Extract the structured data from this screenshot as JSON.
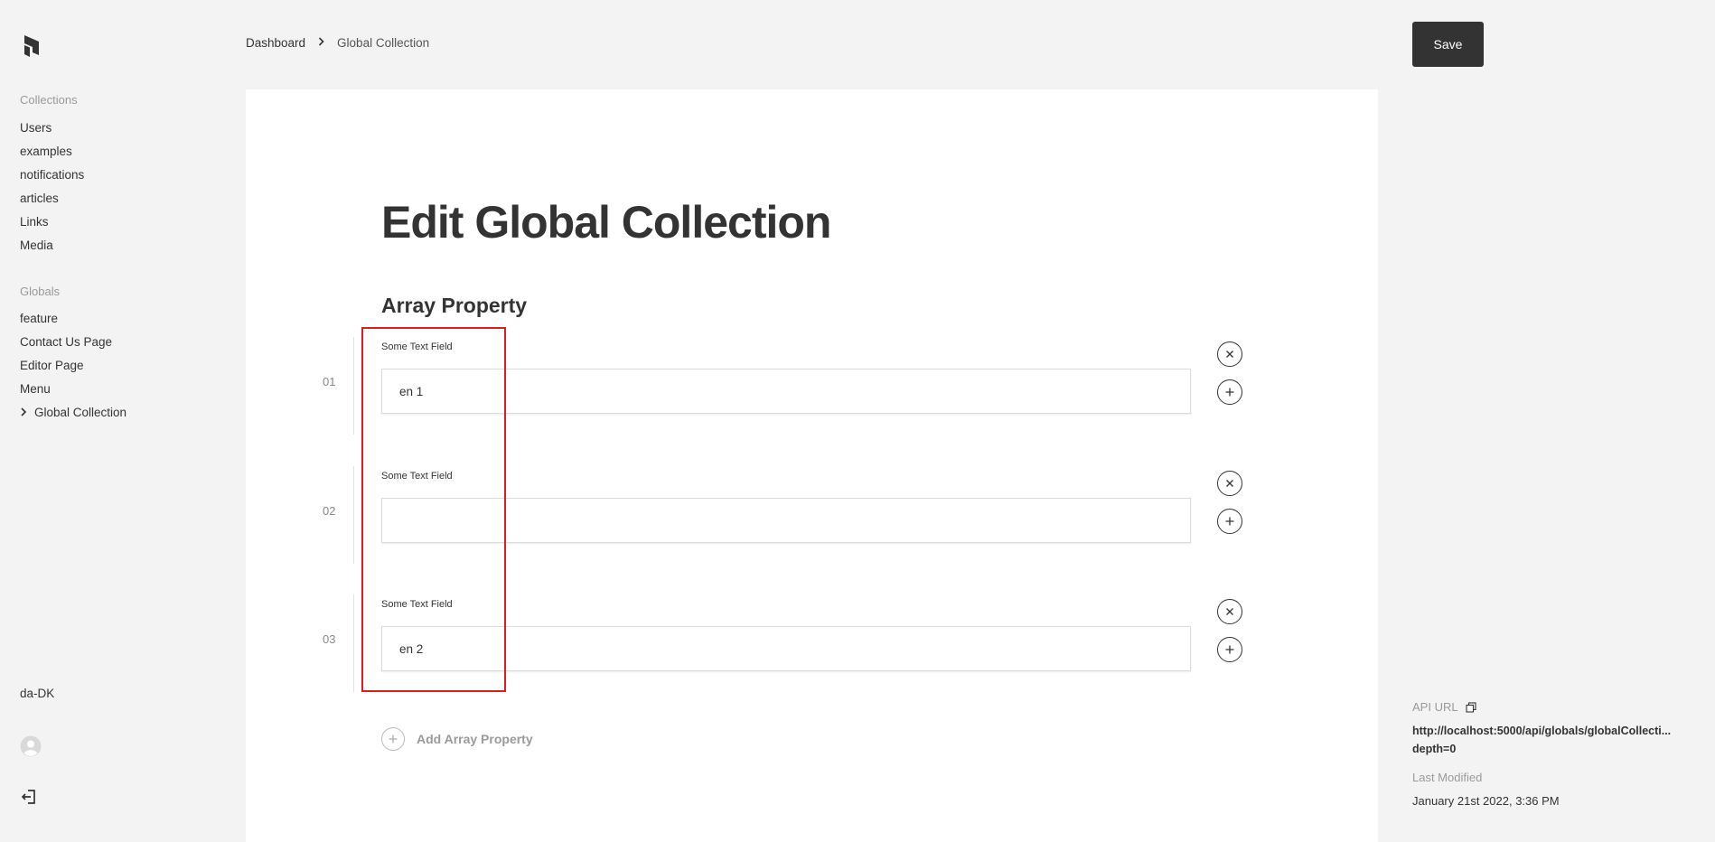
{
  "sidebar": {
    "collections_label": "Collections",
    "collections": [
      {
        "label": "Users"
      },
      {
        "label": "examples"
      },
      {
        "label": "notifications"
      },
      {
        "label": "articles"
      },
      {
        "label": "Links"
      },
      {
        "label": "Media"
      }
    ],
    "globals_label": "Globals",
    "globals": [
      {
        "label": "feature"
      },
      {
        "label": "Contact Us Page"
      },
      {
        "label": "Editor Page"
      },
      {
        "label": "Menu"
      },
      {
        "label": "Global Collection"
      }
    ],
    "locale": "da-DK"
  },
  "breadcrumb": {
    "root": "Dashboard",
    "current": "Global Collection"
  },
  "page": {
    "title": "Edit Global Collection",
    "section_title": "Array Property",
    "rows": [
      {
        "number": "01",
        "label": "Some Text Field",
        "value": "en 1"
      },
      {
        "number": "02",
        "label": "Some Text Field",
        "value": ""
      },
      {
        "number": "03",
        "label": "Some Text Field",
        "value": "en 2"
      }
    ],
    "add_label": "Add Array Property"
  },
  "toolbar": {
    "save_label": "Save"
  },
  "meta": {
    "api_url_label": "API URL",
    "api_url_line1": "http://localhost:5000/api/globals/globalCollecti...",
    "api_url_line2": "depth=0",
    "last_modified_label": "Last Modified",
    "last_modified_value": "January 21st 2022, 3:36 PM"
  },
  "colors": {
    "highlight": "#e21b1b",
    "save_bg": "#333333"
  }
}
